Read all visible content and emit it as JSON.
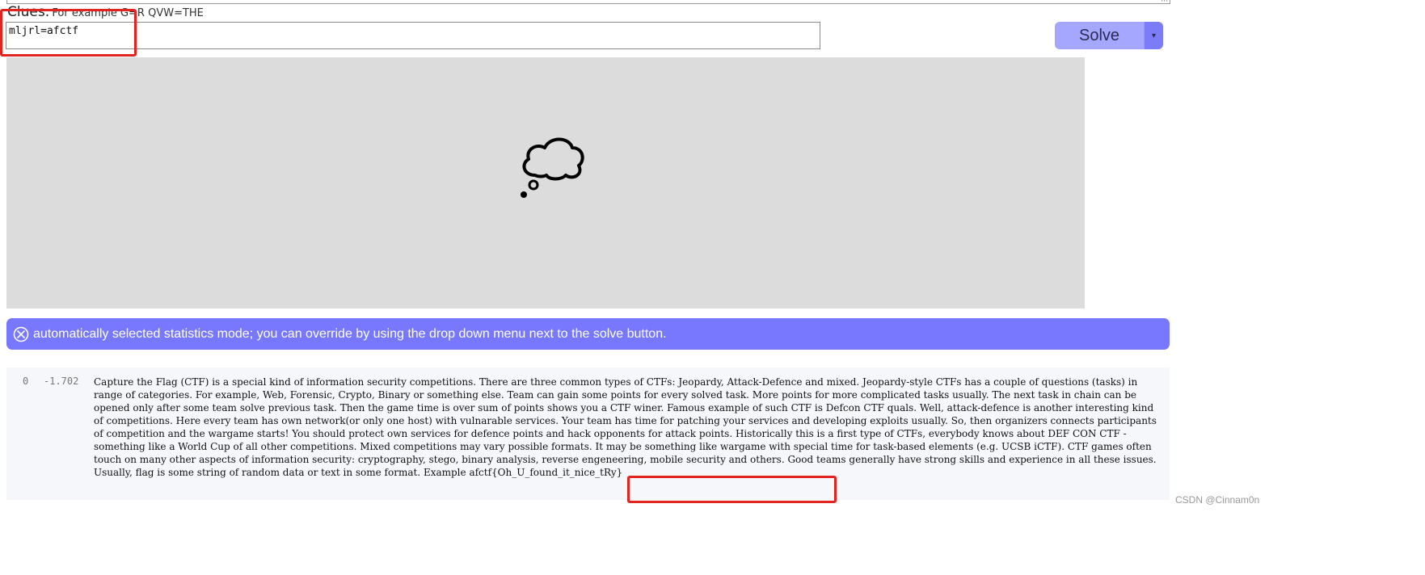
{
  "clues": {
    "label": "Clues:",
    "hint": "For example G=R QVW=THE",
    "value": "mljrl=afctf"
  },
  "solve": {
    "label": "Solve",
    "dropdown_glyph": "▾"
  },
  "canvas": {
    "icon": "thinking-cloud-icon"
  },
  "banner": {
    "icon": "close-circle-icon",
    "text": "automatically selected statistics mode; you can override by using the drop down menu next to the solve button.",
    "color": "#7778fd"
  },
  "result": {
    "index": "0",
    "score": "-1.702",
    "text": "Capture the Flag (CTF) is a special kind of information security competitions. There are three common types of CTFs: Jeopardy, Attack-Defence and mixed. Jeopardy-style CTFs has a couple of questions (tasks) in range of categories. For example, Web, Forensic, Crypto, Binary or something else. Team can gain some points for every solved task. More points for more complicated tasks usually. The next task in chain can be opened only after some team solve previous task. Then the game time is over sum of points shows you a CTF winer. Famous example of such CTF is Defcon CTF quals. Well, attack-defence is another interesting kind of competitions. Here every team has own network(or only one host) with vulnarable services. Your team has time for patching your services and developing exploits usually. So, then organizers connects participants of competition and the wargame starts! You should protect own services for defence points and hack opponents for attack points. Historically this is a first type of CTFs, everybody knows about DEF CON CTF - something like a World Cup of all other competitions. Mixed competitions may vary possible formats. It may be something like wargame with special time for task-based elements (e.g. UCSB iCTF). CTF games often touch on many other aspects of information security: cryptography, stego, binary analysis, reverse engeneering, mobile security and others. Good teams generally have strong skills and experience in all these issues. Usually, flag is some string of random data or text in some format. Example afctf{Oh_U_found_it_nice_tRy}"
  },
  "watermark": "CSDN @Cinnam0n",
  "colors": {
    "highlight": "#e3231f",
    "solve_button": "#a5a7ff",
    "solve_dropdown": "#7d7cf8",
    "canvas_bg": "#dcdcdc"
  }
}
